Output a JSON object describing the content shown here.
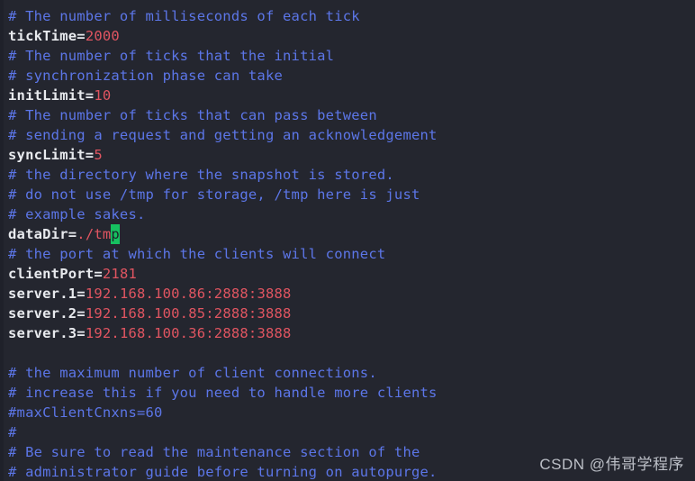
{
  "editor": {
    "background_color": "#24262f",
    "comment_color": "#5c76e8",
    "key_color": "#e8eaee",
    "value_color": "#e05561",
    "cursor_color": "#16c060",
    "filetype": "properties"
  },
  "lines": [
    {
      "type": "comment",
      "text": "# The number of milliseconds of each tick"
    },
    {
      "type": "setting",
      "key": "tickTime",
      "eq": "=",
      "value": "2000"
    },
    {
      "type": "comment",
      "text": "# The number of ticks that the initial"
    },
    {
      "type": "comment",
      "text": "# synchronization phase can take"
    },
    {
      "type": "setting",
      "key": "initLimit",
      "eq": "=",
      "value": "10"
    },
    {
      "type": "comment",
      "text": "# The number of ticks that can pass between"
    },
    {
      "type": "comment",
      "text": "# sending a request and getting an acknowledgement"
    },
    {
      "type": "setting",
      "key": "syncLimit",
      "eq": "=",
      "value": "5"
    },
    {
      "type": "comment",
      "text": "# the directory where the snapshot is stored."
    },
    {
      "type": "comment",
      "text": "# do not use /tmp for storage, /tmp here is just"
    },
    {
      "type": "comment",
      "text": "# example sakes."
    },
    {
      "type": "setting-cursor",
      "key": "dataDir",
      "eq": "=",
      "value_before": "./tm",
      "value_cursor": "p"
    },
    {
      "type": "comment",
      "text": "# the port at which the clients will connect"
    },
    {
      "type": "setting",
      "key": "clientPort",
      "eq": "=",
      "value": "2181"
    },
    {
      "type": "setting",
      "key": "server.1",
      "eq": "=",
      "value": "192.168.100.86:2888:3888"
    },
    {
      "type": "setting",
      "key": "server.2",
      "eq": "=",
      "value": "192.168.100.85:2888:3888"
    },
    {
      "type": "setting",
      "key": "server.3",
      "eq": "=",
      "value": "192.168.100.36:2888:3888"
    },
    {
      "type": "blank",
      "text": ""
    },
    {
      "type": "comment",
      "text": "# the maximum number of client connections."
    },
    {
      "type": "comment",
      "text": "# increase this if you need to handle more clients"
    },
    {
      "type": "comment",
      "text": "#maxClientCnxns=60"
    },
    {
      "type": "comment",
      "text": "#"
    },
    {
      "type": "comment",
      "text": "# Be sure to read the maintenance section of the"
    },
    {
      "type": "comment",
      "text": "# administrator guide before turning on autopurge."
    }
  ],
  "watermark": {
    "text": "CSDN @伟哥学程序"
  }
}
